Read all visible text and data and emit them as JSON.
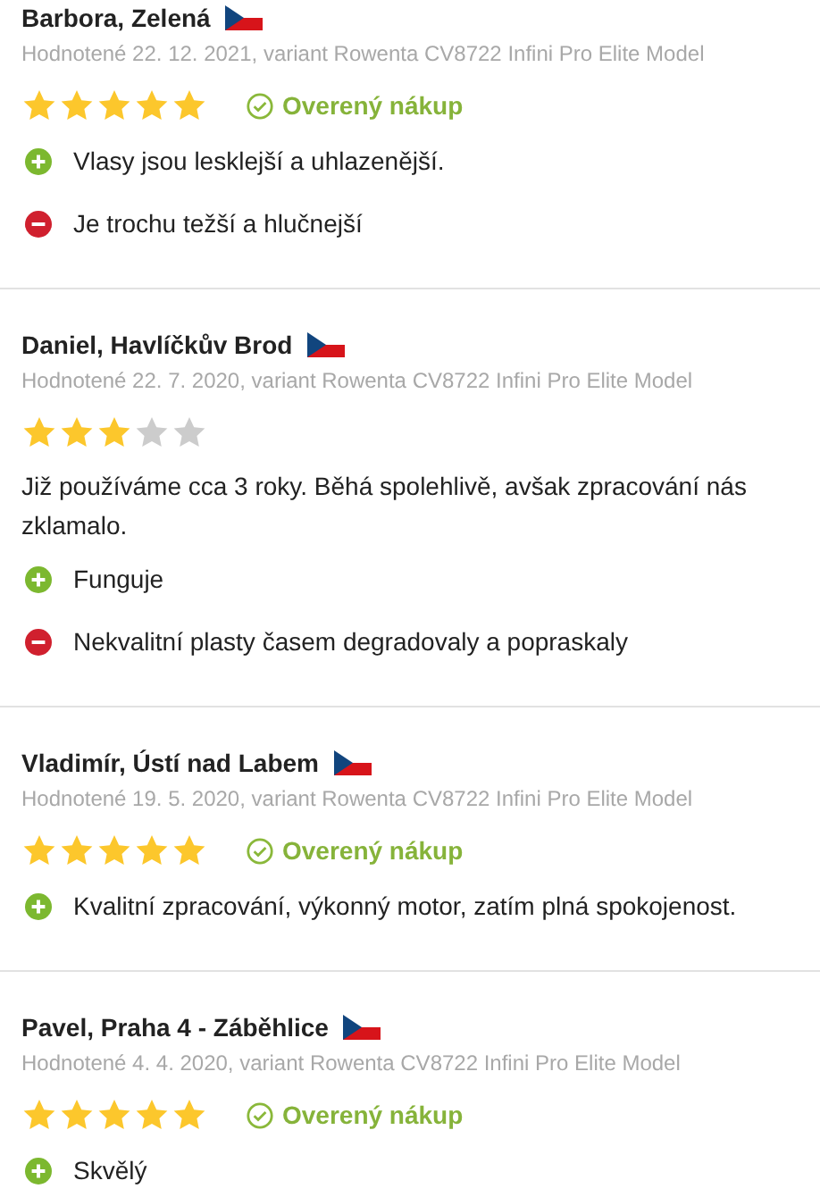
{
  "reviews": [
    {
      "name": "Barbora, Zelená",
      "meta": "Hodnotené 22. 12. 2021, variant Rowenta CV8722 Infini Pro Elite Model",
      "stars": 5,
      "badge": "Overený nákup",
      "points": [
        {
          "kind": "pro",
          "text": "Vlasy jsou lesklejší a uhlazenější."
        },
        {
          "kind": "con",
          "text": "Je trochu težší a hlučnejší"
        }
      ]
    },
    {
      "name": "Daniel, Havlíčkův Brod",
      "meta": "Hodnotené 22. 7. 2020, variant Rowenta CV8722 Infini Pro Elite Model",
      "stars": 3,
      "text": "Již používáme cca 3 roky. Běhá spolehlivě, avšak zpracování nás zklamalo.",
      "points": [
        {
          "kind": "pro",
          "text": "Funguje"
        },
        {
          "kind": "con",
          "text": "Nekvalitní plasty časem degradovaly a popraskaly"
        }
      ]
    },
    {
      "name": "Vladimír, Ústí nad Labem",
      "meta": "Hodnotené 19. 5. 2020, variant Rowenta CV8722 Infini Pro Elite Model",
      "stars": 5,
      "badge": "Overený nákup",
      "points": [
        {
          "kind": "pro",
          "text": "Kvalitní zpracování, výkonný motor, zatím plná spokojenost."
        }
      ]
    },
    {
      "name": "Pavel, Praha 4 - Záběhlice",
      "meta": "Hodnotené 4. 4. 2020, variant Rowenta CV8722 Infini Pro Elite Model",
      "stars": 5,
      "badge": "Overený nákup",
      "points": [
        {
          "kind": "pro",
          "text": "Skvělý"
        }
      ]
    }
  ]
}
